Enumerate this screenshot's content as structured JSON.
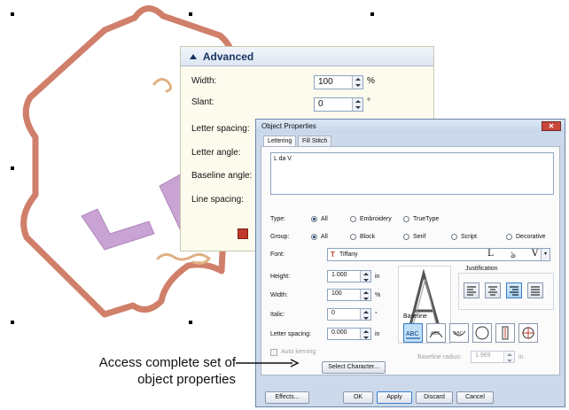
{
  "advanced_panel": {
    "title": "Advanced",
    "width_label": "Width:",
    "width_value": "100",
    "width_unit": "%",
    "slant_label": "Slant:",
    "slant_value": "0",
    "slant_unit": "°",
    "letter_spacing_label": "Letter spacing:",
    "letter_angle_label": "Letter angle:",
    "baseline_angle_label": "Baseline angle:",
    "line_spacing_label": "Line spacing:"
  },
  "dialog": {
    "title": "Object Properties",
    "tabs": [
      "Lettering",
      "Fill Stitch"
    ],
    "text_value": "L da V",
    "type_label": "Type:",
    "type_options": [
      "All",
      "Embroidery",
      "TrueType"
    ],
    "type_selected": "All",
    "group_label": "Group:",
    "group_options": [
      "All",
      "Block",
      "Serif",
      "Script",
      "Decorative"
    ],
    "group_selected": "All",
    "font_label": "Font:",
    "font_value": "Tiffany",
    "font_preview_glyphs": [
      "L",
      "ঌ",
      "V"
    ],
    "height_label": "Height:",
    "height_value": "1.000",
    "height_unit": "in",
    "width_label": "Width:",
    "width_value": "100",
    "width_unit": "%",
    "italic_label": "Italic:",
    "italic_value": "0",
    "italic_unit": "°",
    "letter_spacing_label": "Letter spacing:",
    "letter_spacing_value": "0.000",
    "letter_spacing_unit": "in",
    "auto_kerning_label": "Auto kerning",
    "select_character_label": "Select Character...",
    "justification_label": "Justification",
    "baseline_label": "Baseline",
    "baseline_radius_label": "Baseline radius:",
    "baseline_radius_value": "1.969",
    "baseline_radius_unit": "in",
    "buttons": {
      "effects": "Effects...",
      "ok": "OK",
      "apply": "Apply",
      "discard": "Discard",
      "cancel": "Cancel"
    }
  },
  "callout": {
    "line1": "Access complete set of",
    "line2": "object properties"
  },
  "colors": {
    "frame_outline": "#d07f6a",
    "lettering_fill": "#c9a3d3",
    "ornament": "#e0b183",
    "panel_header_text": "#17345f",
    "dialog_chrome": "#cbd9ea",
    "selected_button": "#3a7cc4"
  }
}
